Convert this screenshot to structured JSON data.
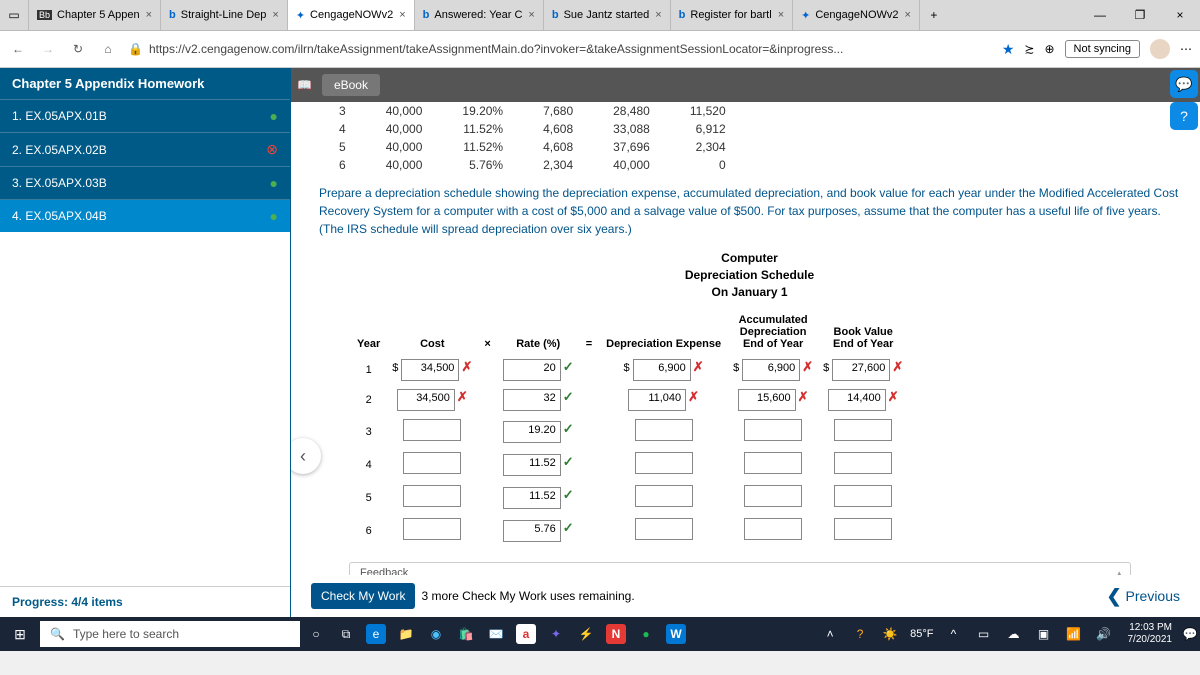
{
  "browser": {
    "tabs": [
      {
        "icon": "Bb",
        "title": "Chapter 5 Appen"
      },
      {
        "icon": "b",
        "title": "Straight-Line Dep"
      },
      {
        "icon": "✦",
        "title": "CengageNOWv2",
        "active": true
      },
      {
        "icon": "b",
        "title": "Answered: Year C"
      },
      {
        "icon": "b",
        "title": "Sue Jantz started"
      },
      {
        "icon": "b",
        "title": "Register for bartl"
      },
      {
        "icon": "✦",
        "title": "CengageNOWv2"
      }
    ],
    "url": "https://v2.cengagenow.com/ilrn/takeAssignment/takeAssignmentMain.do?invoker=&takeAssignmentSessionLocator=&inprogress...",
    "not_syncing": "Not syncing"
  },
  "assignment": {
    "title": "Chapter 5 Appendix Homework",
    "ebook": "eBook",
    "nav": [
      {
        "label": "1. EX.05APX.01B",
        "status": "green"
      },
      {
        "label": "2. EX.05APX.02B",
        "status": "red"
      },
      {
        "label": "3. EX.05APX.03B",
        "status": "green"
      },
      {
        "label": "4. EX.05APX.04B",
        "status": "green",
        "selected": true
      }
    ],
    "progress": "Progress: 4/4 items"
  },
  "pretable": [
    [
      "3",
      "40,000",
      "19.20%",
      "7,680",
      "28,480",
      "11,520"
    ],
    [
      "4",
      "40,000",
      "11.52%",
      "4,608",
      "33,088",
      "6,912"
    ],
    [
      "5",
      "40,000",
      "11.52%",
      "4,608",
      "37,696",
      "2,304"
    ],
    [
      "6",
      "40,000",
      "5.76%",
      "2,304",
      "40,000",
      "0"
    ]
  ],
  "instructions": "Prepare a depreciation schedule showing the depreciation expense, accumulated depreciation, and book value for each year under the Modified Accelerated Cost Recovery System for a computer with a cost of $5,000 and a salvage value of $500. For tax purposes, assume that the computer has a useful life of five years. (The IRS schedule will spread depreciation over six years.)",
  "schedule": {
    "title_l1": "Computer",
    "title_l2": "Depreciation Schedule",
    "title_l3": "On January 1",
    "headers": {
      "year": "Year",
      "cost": "Cost",
      "x": "×",
      "rate": "Rate (%)",
      "eq": "=",
      "expense": "Depreciation Expense",
      "accum_l1": "Accumulated",
      "accum_l2": "Depreciation",
      "accum_l3": "End of Year",
      "bv_l1": "Book Value",
      "bv_l2": "End of Year"
    },
    "rows": [
      {
        "year": "1",
        "cost": "34,500",
        "cost_mark": "bad",
        "rate": "20",
        "rate_mark": "ok",
        "exp": "6,900",
        "exp_mark": "bad",
        "acc": "6,900",
        "acc_mark": "bad",
        "bv": "27,600",
        "bv_mark": "bad",
        "prefix": true
      },
      {
        "year": "2",
        "cost": "34,500",
        "cost_mark": "bad",
        "rate": "32",
        "rate_mark": "ok",
        "exp": "11,040",
        "exp_mark": "bad",
        "acc": "15,600",
        "acc_mark": "bad",
        "bv": "14,400",
        "bv_mark": "bad"
      },
      {
        "year": "3",
        "cost": "",
        "rate": "19.20",
        "rate_mark": "ok",
        "exp": "",
        "acc": "",
        "bv": ""
      },
      {
        "year": "4",
        "cost": "",
        "rate": "11.52",
        "rate_mark": "ok",
        "exp": "",
        "acc": "",
        "bv": ""
      },
      {
        "year": "5",
        "cost": "",
        "rate": "11.52",
        "rate_mark": "ok",
        "exp": "",
        "acc": "",
        "bv": ""
      },
      {
        "year": "6",
        "cost": "",
        "rate": "5.76",
        "rate_mark": "ok",
        "exp": "",
        "acc": "",
        "bv": ""
      }
    ]
  },
  "feedback": "Feedback",
  "check": "Check My Work",
  "remaining": "3 more Check My Work uses remaining.",
  "previous": "Previous",
  "taskbar": {
    "search": "Type here to search",
    "temp": "85°F",
    "time": "12:03 PM",
    "date": "7/20/2021"
  }
}
